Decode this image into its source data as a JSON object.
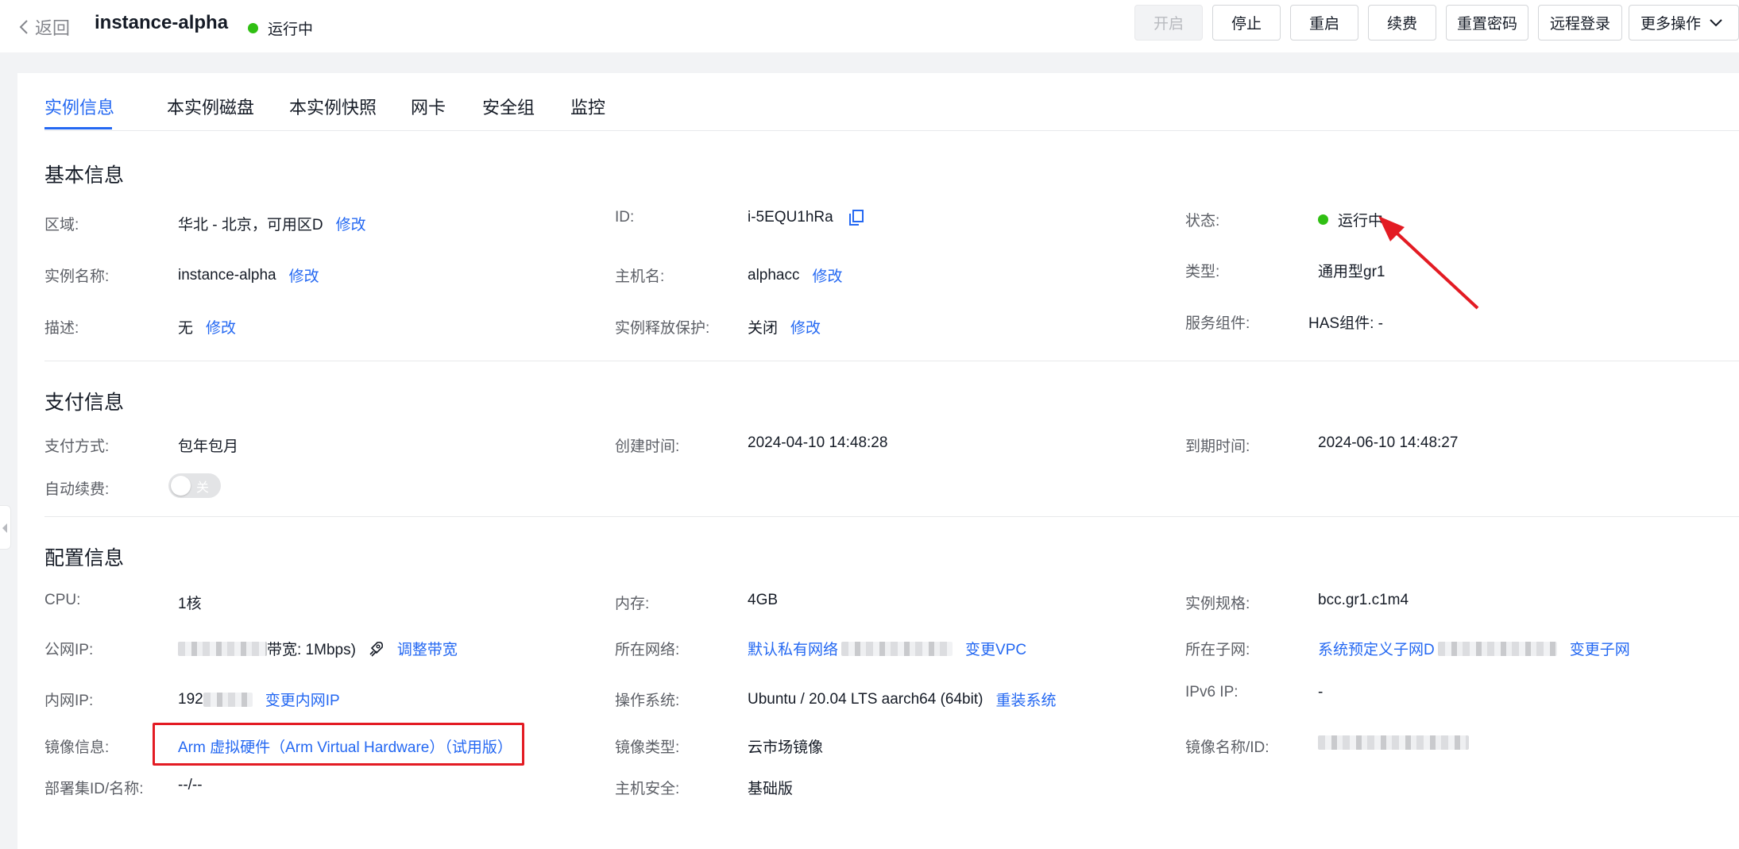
{
  "header": {
    "back_label": "返回",
    "instance_name": "instance-alpha",
    "status": "运行中",
    "status_color": "#30bf13",
    "actions": [
      "开启",
      "停止",
      "重启",
      "续费",
      "重置密码",
      "远程登录",
      "更多操作"
    ],
    "disabled_actions": [
      "开启"
    ]
  },
  "tabs": [
    "实例信息",
    "本实例磁盘",
    "本实例快照",
    "网卡",
    "安全组",
    "监控"
  ],
  "active_tab": "实例信息",
  "basic": {
    "title": "基本信息",
    "region_label": "区域:",
    "region_value": "华北 - 北京，可用区D",
    "region_action": "修改",
    "id_label": "ID:",
    "id_value": "i-5EQU1hRa",
    "status_label": "状态:",
    "status_value": "运行中",
    "name_label": "实例名称:",
    "name_value": "instance-alpha",
    "name_action": "修改",
    "hostname_label": "主机名:",
    "hostname_value": "alphacc",
    "hostname_action": "修改",
    "type_label": "类型:",
    "type_value": "通用型gr1",
    "desc_label": "描述:",
    "desc_value": "无",
    "desc_action": "修改",
    "protect_label": "实例释放保护:",
    "protect_value": "关闭",
    "protect_action": "修改",
    "service_label": "服务组件:",
    "service_value": "HAS组件: -"
  },
  "payment": {
    "title": "支付信息",
    "method_label": "支付方式:",
    "method_value": "包年包月",
    "created_label": "创建时间:",
    "created_value": "2024-04-10 14:48:28",
    "expire_label": "到期时间:",
    "expire_value": "2024-06-10 14:48:27",
    "autorenew_label": "自动续费:",
    "autorenew_value": "关"
  },
  "config": {
    "title": "配置信息",
    "cpu_label": "CPU:",
    "cpu_value": "1核",
    "mem_label": "内存:",
    "mem_value": "4GB",
    "spec_label": "实例规格:",
    "spec_value": "bcc.gr1.c1m4",
    "public_ip_label": "公网IP:",
    "public_ip_bw": "带宽: 1Mbps)",
    "public_ip_action": "调整带宽",
    "network_label": "所在网络:",
    "network_value": "默认私有网络",
    "network_action": "变更VPC",
    "subnet_label": "所在子网:",
    "subnet_value": "系统预定义子网D",
    "subnet_action": "变更子网",
    "private_ip_label": "内网IP:",
    "private_ip_value": "192",
    "private_ip_action": "变更内网IP",
    "os_label": "操作系统:",
    "os_value": "Ubuntu / 20.04 LTS aarch64 (64bit)",
    "os_action": "重装系统",
    "ipv6_label": "IPv6 IP:",
    "ipv6_value": "-",
    "image_label": "镜像信息:",
    "image_value": "Arm 虚拟硬件（Arm Virtual Hardware）（试用版）",
    "image_type_label": "镜像类型:",
    "image_type_value": "云市场镜像",
    "image_name_label": "镜像名称/ID:",
    "deploy_label": "部署集ID/名称:",
    "deploy_value": "--/--",
    "security_label": "主机安全:",
    "security_value": "基础版"
  },
  "colors": {
    "accent": "#2468f2",
    "highlight_box": "#e31b23",
    "arrow": "#e31b23"
  }
}
